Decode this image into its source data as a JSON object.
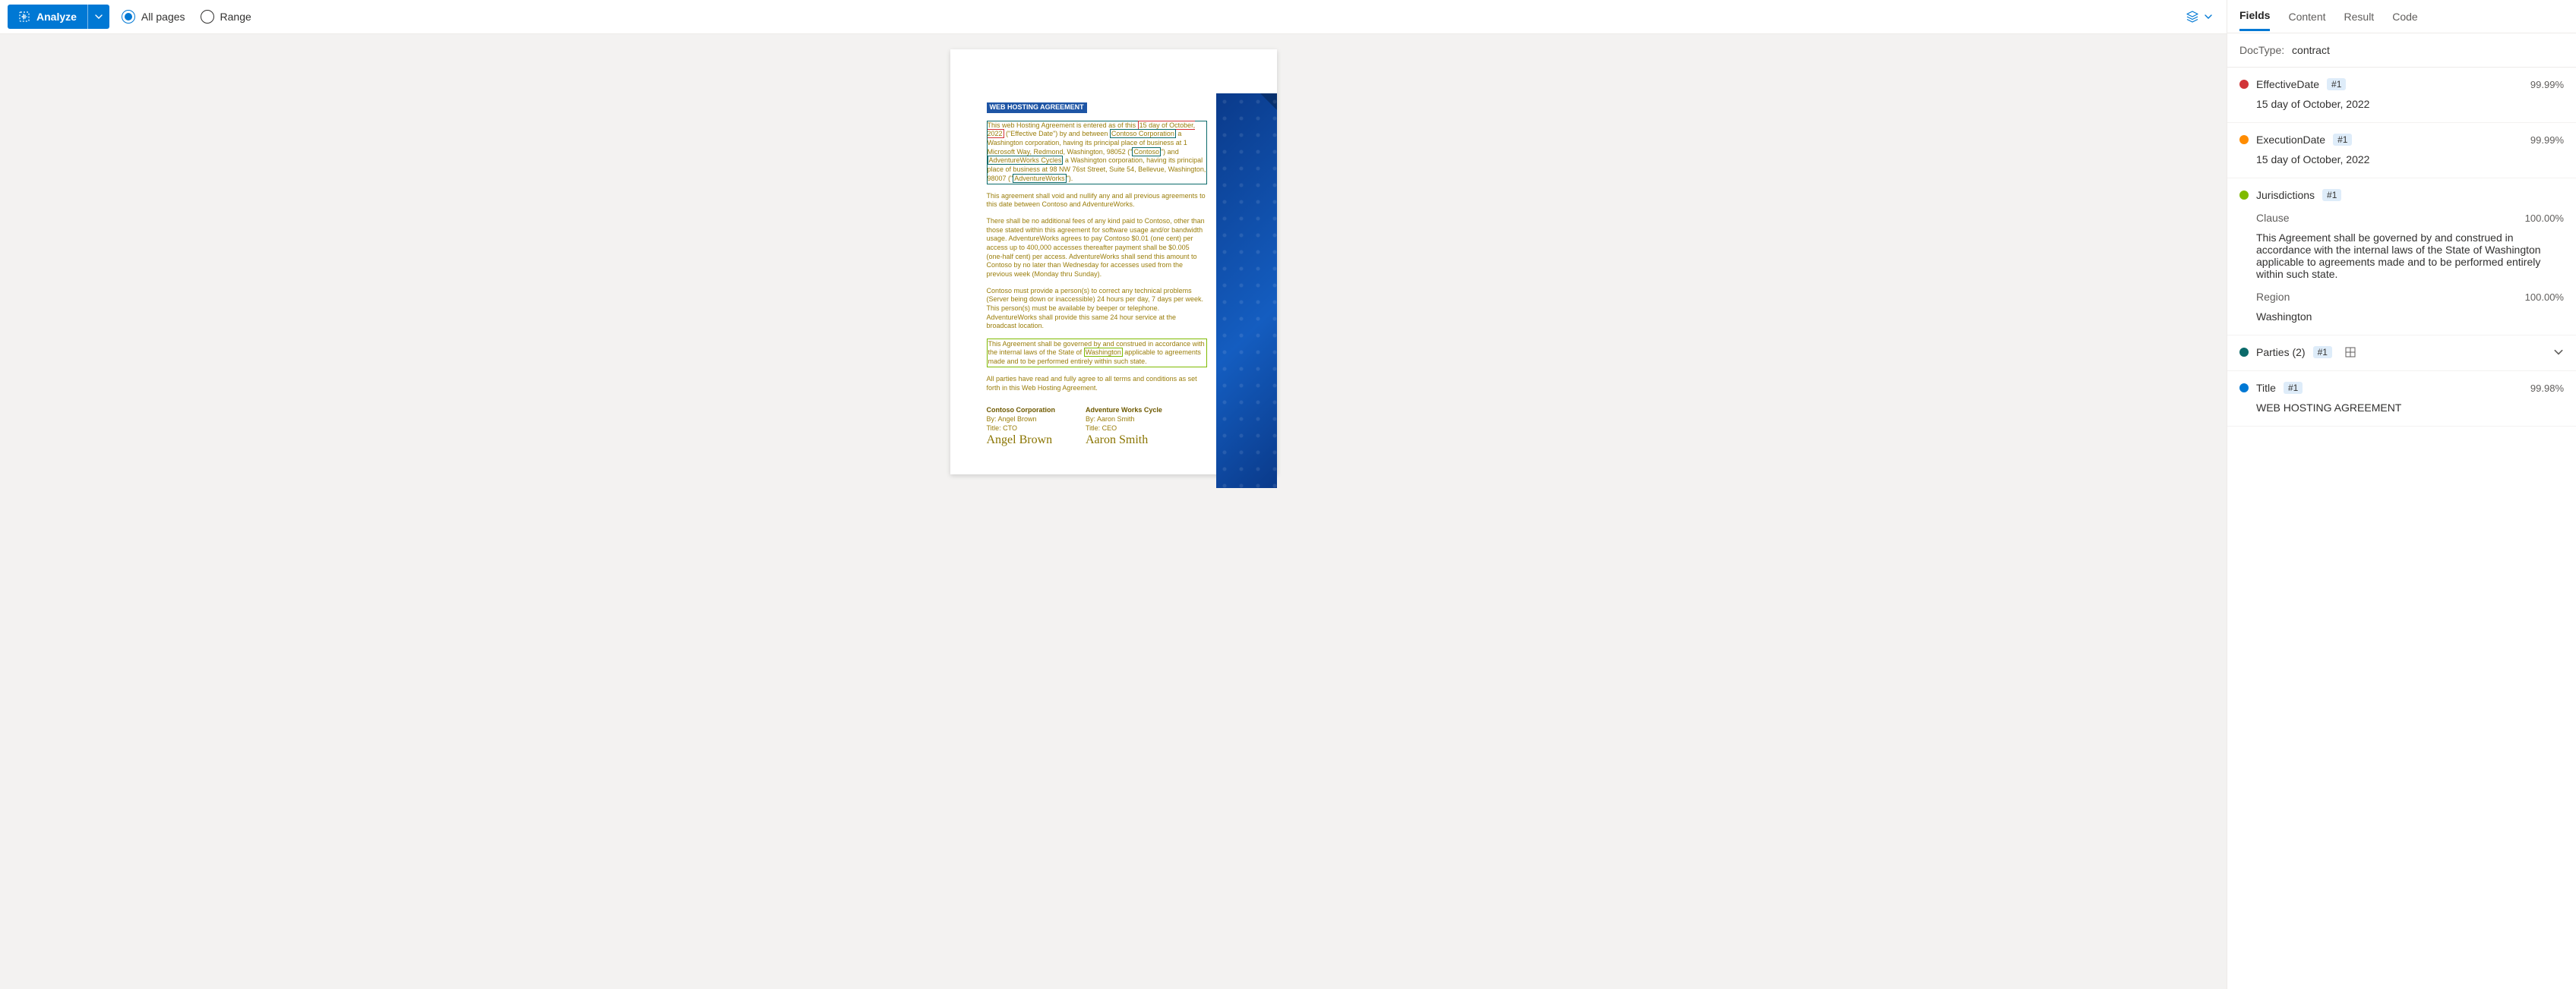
{
  "toolbar": {
    "analyze_label": "Analyze",
    "radio_all": "All pages",
    "radio_range": "Range"
  },
  "tabs": {
    "fields": "Fields",
    "content": "Content",
    "result": "Result",
    "code": "Code"
  },
  "doctype": {
    "label": "DocType:",
    "value": "contract"
  },
  "fields": {
    "effective": {
      "name": "EffectiveDate",
      "pill": "#1",
      "conf": "99.99%",
      "value": "15 day of October, 2022"
    },
    "execution": {
      "name": "ExecutionDate",
      "pill": "#1",
      "conf": "99.99%",
      "value": "15 day of October, 2022"
    },
    "juris": {
      "name": "Jurisdictions",
      "pill": "#1",
      "clause_label": "Clause",
      "clause_conf": "100.00%",
      "clause_text": "This Agreement shall be governed by and construed in accordance with the internal laws of the State of Washington applicable to agreements made and to be performed entirely within such state.",
      "region_label": "Region",
      "region_conf": "100.00%",
      "region_value": "Washington"
    },
    "parties": {
      "name": "Parties (2)",
      "pill": "#1"
    },
    "title": {
      "name": "Title",
      "pill": "#1",
      "conf": "99.98%",
      "value": "WEB HOSTING AGREEMENT"
    }
  },
  "doc": {
    "title": "WEB HOSTING AGREEMENT",
    "p1a": "This web Hosting Agreement is entered as of this ",
    "p1_date": "15 day of October, 2022",
    "p1b": "(\"Effective Date\") by and between ",
    "p1_co": "Contoso Corporation",
    "p1c": " a Washington corporation, having its principal place of business at 1 Microsoft Way, Redmond, Washington, 98052 (\"",
    "p1_contoso": "Contoso",
    "p1d": "\") and ",
    "p1_aw": "AdventureWorks Cycles",
    "p1e": " a Washington corporation, having its principal place of business at 98 NW 76st Street, Suite 54, Bellevue, Washington, 98007 (\"",
    "p1_aw2": "AdventureWorks",
    "p1f": "\").",
    "p2": "This agreement shall void and nullify any and all previous agreements to this date between Contoso and AdventureWorks.",
    "p3": "There shall be no additional fees of any kind paid to Contoso, other than those stated within this agreement for software usage and/or bandwidth usage. AdventureWorks agrees to pay Contoso $0.01 (one cent) per access up to 400,000 accesses thereafter payment shall be $0.005 (one-half cent) per access. AdventureWorks shall send this amount to Contoso by no later than Wednesday for accesses used from the previous week (Monday thru Sunday).",
    "p4": "Contoso must provide a person(s) to correct any technical problems (Server being down or inaccessible) 24 hours per day, 7 days per week. This person(s) must be available by beeper or telephone. AdventureWorks shall provide this same 24 hour service at the broadcast location.",
    "p5a": "This Agreement shall be governed by and construed in accordance with the internal laws of the State of ",
    "p5_state": "Washington",
    "p5b": " applicable to agreements made and to be performed entirely within such state.",
    "p6": "All parties have read and fully agree to all terms and conditions as set forth in this Web Hosting Agreement.",
    "sig1": {
      "company": "Contoso Corporation",
      "by": "By: Angel Brown",
      "title": "Title: CTO",
      "sign": "Angel Brown"
    },
    "sig2": {
      "company": "Adventure Works Cycle",
      "by": "By: Aaron Smith",
      "title": "Title: CEO",
      "sign": "Aaron Smith"
    }
  }
}
